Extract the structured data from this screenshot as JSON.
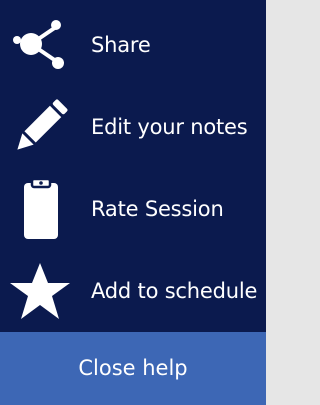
{
  "menu": {
    "items": [
      {
        "label": "Share",
        "icon": "share-icon"
      },
      {
        "label": "Edit your notes",
        "icon": "pencil-icon"
      },
      {
        "label": "Rate Session",
        "icon": "clipboard-icon"
      },
      {
        "label": "Add to schedule",
        "icon": "star-icon"
      }
    ]
  },
  "close_button": {
    "label": "Close help"
  },
  "colors": {
    "panel_background": "#0b1a4e",
    "close_button_background": "#3d67b5",
    "text": "#ffffff",
    "icon": "#ffffff"
  }
}
